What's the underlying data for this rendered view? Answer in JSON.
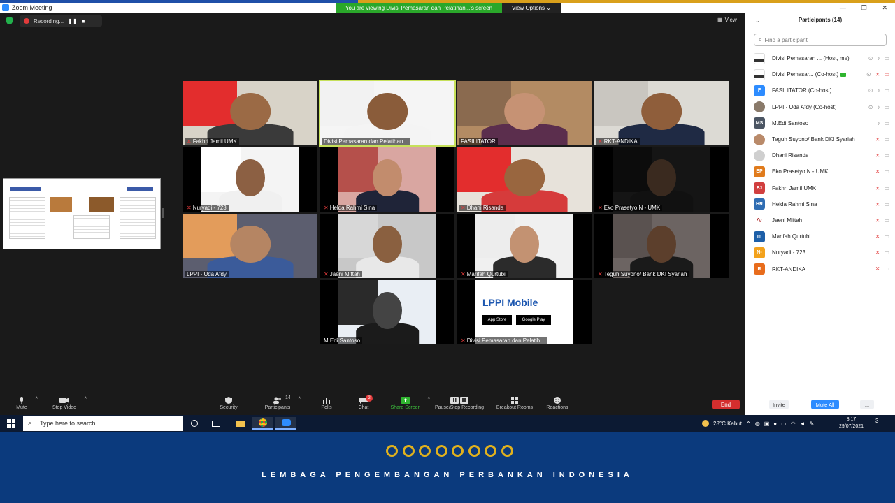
{
  "window": {
    "title": "Zoom Meeting",
    "viewing_banner": "You are viewing Divisi Pemasaran dan Pelatihan...'s screen",
    "view_options": "View Options ⌄",
    "controls": [
      "—",
      "❐",
      "✕"
    ]
  },
  "meeting": {
    "recording_label": "Recording...",
    "view_label": "View",
    "tiles": [
      {
        "name": "Fakhri Jamil UMK",
        "muted": true,
        "bg": "#e32d2d",
        "skin": "#9b6a45",
        "shirt": "#3a3a3a",
        "wall": "#d8d3c8"
      },
      {
        "name": "Divisi Pemasaran dan Pelatihan...",
        "muted": false,
        "bg": "#f2f2f2",
        "skin": "#8a5c3a",
        "shirt": "#f4f4f4",
        "wall": "#f5f5f5",
        "active": true
      },
      {
        "name": "FASILITATOR",
        "muted": false,
        "bg": "#8a6a4f",
        "skin": "#c69274",
        "shirt": "#5b2e4d",
        "wall": "#b38b63"
      },
      {
        "name": "RKT-ANDIKA",
        "muted": true,
        "bg": "#c9c6c0",
        "skin": "#8f5e3b",
        "shirt": "#1f2a44",
        "wall": "#dcdad4"
      },
      {
        "name": "Nuryadi - 723",
        "muted": true,
        "bg": "#ffffff",
        "skin": "#8c6043",
        "shirt": "#f0f0f0",
        "wall": "#f4f4f4",
        "narrow": true
      },
      {
        "name": "Helda Rahmi Sina",
        "muted": true,
        "bg": "#b5504b",
        "skin": "#c28c6d",
        "shirt": "#1f2438",
        "wall": "#d9a6a1",
        "narrow": true
      },
      {
        "name": "Dhani Risanda",
        "muted": true,
        "bg": "#e32d2d",
        "skin": "#99663f",
        "shirt": "#d63b3b",
        "wall": "#e7e2da"
      },
      {
        "name": "Eko Prasetyo N - UMK",
        "muted": true,
        "bg": "#0c0c0c",
        "skin": "#3a2a1f",
        "shirt": "#111111",
        "wall": "#151515",
        "narrow": true
      },
      {
        "name": "LPPI - Uda Afdy",
        "muted": false,
        "bg": "#e39c5b",
        "skin": "#b58563",
        "shirt": "#3b5b9a",
        "wall": "#5c5e6f"
      },
      {
        "name": "Jaeni Miftah",
        "muted": true,
        "bg": "#d7d7d7",
        "skin": "#8a6040",
        "shirt": "#e8e8e8",
        "wall": "#c8c8c8",
        "narrow": true
      },
      {
        "name": "Marifah Qurtubi",
        "muted": true,
        "bg": "#ededed",
        "skin": "#c39272",
        "shirt": "#2b2b2b",
        "wall": "#f0f0f0",
        "narrow": true
      },
      {
        "name": "Teguh Suyono/ Bank DKI Syariah",
        "muted": true,
        "bg": "#5a5250",
        "skin": "#5c3f2c",
        "shirt": "#1a1a1a",
        "wall": "#6c6462",
        "narrow": true
      },
      {
        "name": "M.Edi Santoso",
        "muted": false,
        "bg": "#2a2a2a",
        "skin": "#444444",
        "shirt": "#1b1b1b",
        "wall": "#e9eef4",
        "narrow": true
      },
      {
        "name": "Divisi Pemasaran dan Pelatih...",
        "muted": true,
        "bg": "#ffffff",
        "skin": "#ffffff",
        "shirt": "#ffffff",
        "wall": "#ffffff",
        "narrow": true,
        "lppi": true
      }
    ],
    "lppi_tile": {
      "title": "LPPI Mobile",
      "store1": "App Store",
      "store2": "Google Play"
    }
  },
  "toolbar": {
    "mute": "Mute",
    "stop_video": "Stop Video",
    "security": "Security",
    "participants": "Participants",
    "participants_count": "14",
    "polls": "Polls",
    "chat": "Chat",
    "chat_badge": "2",
    "share_screen": "Share Screen",
    "pause_recording": "Pause/Stop Recording",
    "breakout_rooms": "Breakout Rooms",
    "reactions": "Reactions",
    "end": "End"
  },
  "participants_panel": {
    "title": "Participants (14)",
    "search_placeholder": "Find a participant",
    "invite": "Invite",
    "mute_all": "Mute All",
    "more": "...",
    "items": [
      {
        "name": "Divisi Pemasaran ... (Host, me)",
        "initials": "",
        "color": "#ffffff",
        "mic_on": true,
        "video_on": true,
        "logo": true
      },
      {
        "name": "Divisi Pemasar... (Co-host)",
        "initials": "",
        "color": "#ffffff",
        "mic_on": false,
        "video_on": false,
        "logo": true,
        "share": true
      },
      {
        "name": "FASILITATOR (Co-host)",
        "initials": "F",
        "color": "#2d8cff",
        "mic_on": true,
        "video_on": true
      },
      {
        "name": "LPPI - Uda Afdy (Co-host)",
        "initials": "",
        "color": "#8a7a6a",
        "mic_on": true,
        "video_on": true,
        "photo": true
      },
      {
        "name": "M.Edi Santoso",
        "initials": "MS",
        "color": "#4b5563",
        "mic_on": true,
        "video_on": true
      },
      {
        "name": "Teguh Suyono/ Bank DKI Syariah",
        "initials": "",
        "color": "#b98a6a",
        "mic_on": false,
        "video_on": true,
        "photo": true
      },
      {
        "name": "Dhani Risanda",
        "initials": "",
        "color": "#cfcfcf",
        "mic_on": false,
        "video_on": true,
        "photo": true
      },
      {
        "name": "Eko Prasetyo N - UMK",
        "initials": "EP",
        "color": "#e07b1c",
        "mic_on": false,
        "video_on": true
      },
      {
        "name": "Fakhri Jamil UMK",
        "initials": "FJ",
        "color": "#d13f3f",
        "mic_on": false,
        "video_on": true
      },
      {
        "name": "Helda Rahmi Sina",
        "initials": "HR",
        "color": "#2f6db3",
        "mic_on": false,
        "video_on": true
      },
      {
        "name": "Jaeni Miftah",
        "initials": "",
        "color": "#ffffff",
        "mic_on": false,
        "video_on": true,
        "scribble": true
      },
      {
        "name": "Marifah Qurtubi",
        "initials": "m",
        "color": "#1d5fa8",
        "mic_on": false,
        "video_on": true
      },
      {
        "name": "Nuryadi - 723",
        "initials": "N-",
        "color": "#f3a21c",
        "mic_on": false,
        "video_on": true
      },
      {
        "name": "RKT-ANDIKA",
        "initials": "R",
        "color": "#e86c1c",
        "mic_on": false,
        "video_on": true
      }
    ]
  },
  "taskbar": {
    "search_placeholder": "Type here to search",
    "weather": "28°C  Kabut",
    "time": "8:17",
    "date": "29/07/2021",
    "notifications": "3"
  },
  "banner": {
    "text": "LEMBAGA PENGEMBANGAN PERBANKAN INDONESIA",
    "ring_color": "#e0b11e",
    "bg_color": "#0b3a7d"
  }
}
